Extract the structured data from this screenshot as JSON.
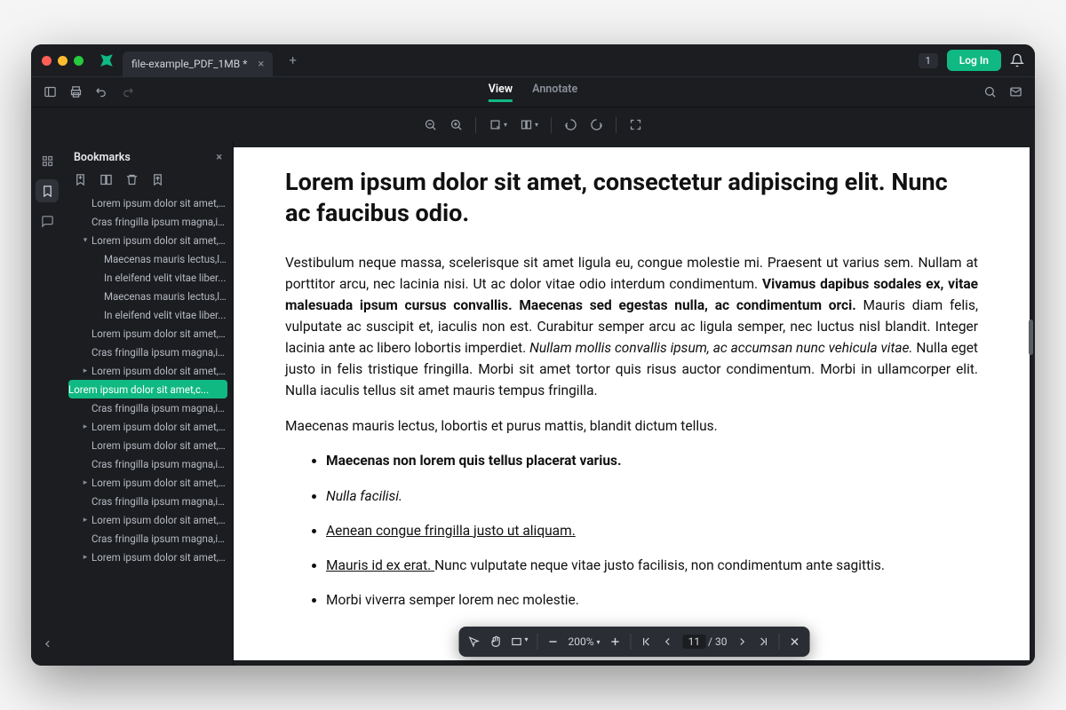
{
  "titlebar": {
    "tab_name": "file-example_PDF_1MB *",
    "count": "1",
    "login": "Log In"
  },
  "modes": {
    "view": "View",
    "annotate": "Annotate"
  },
  "sidebar": {
    "title": "Bookmarks",
    "items": [
      {
        "indent": 0,
        "chev": "",
        "label": "Lorem ipsum dolor sit amet,c..."
      },
      {
        "indent": 0,
        "chev": "",
        "label": "Cras fringilla ipsum magna,in..."
      },
      {
        "indent": 0,
        "chev": "v",
        "label": "Lorem ipsum dolor sit amet,c..."
      },
      {
        "indent": 1,
        "chev": "",
        "label": "Maecenas mauris lectus,l..."
      },
      {
        "indent": 1,
        "chev": "",
        "label": "In eleifend velit vitae liber..."
      },
      {
        "indent": 1,
        "chev": "",
        "label": "Maecenas mauris lectus,l..."
      },
      {
        "indent": 1,
        "chev": "",
        "label": "In eleifend velit vitae liber..."
      },
      {
        "indent": 0,
        "chev": "",
        "label": "Lorem ipsum dolor sit amet,c..."
      },
      {
        "indent": 0,
        "chev": "",
        "label": "Cras fringilla ipsum magna,in..."
      },
      {
        "indent": 0,
        "chev": ">",
        "label": "Lorem ipsum dolor sit amet,c..."
      },
      {
        "indent": 0,
        "chev": "",
        "label": "Lorem ipsum dolor sit amet,c...",
        "selected": true
      },
      {
        "indent": 0,
        "chev": "",
        "label": "Cras fringilla ipsum magna,in..."
      },
      {
        "indent": 0,
        "chev": ">",
        "label": "Lorem ipsum dolor sit amet,c..."
      },
      {
        "indent": 0,
        "chev": "",
        "label": "Lorem ipsum dolor sit amet,c..."
      },
      {
        "indent": 0,
        "chev": "",
        "label": "Cras fringilla ipsum magna,in..."
      },
      {
        "indent": 0,
        "chev": ">",
        "label": "Lorem ipsum dolor sit amet,c..."
      },
      {
        "indent": 0,
        "chev": "",
        "label": "Cras fringilla ipsum magna,in..."
      },
      {
        "indent": 0,
        "chev": ">",
        "label": "Lorem ipsum dolor sit amet,c..."
      },
      {
        "indent": 0,
        "chev": "",
        "label": "Cras fringilla ipsum magna,in..."
      },
      {
        "indent": 0,
        "chev": ">",
        "label": "Lorem ipsum dolor sit amet,c..."
      }
    ]
  },
  "doc": {
    "heading": "Lorem ipsum dolor sit amet, consectetur adipiscing elit. Nunc ac faucibus odio.",
    "p1_a": "Vestibulum neque massa, scelerisque sit amet ligula eu, congue molestie mi. Praesent ut varius sem. Nullam at porttitor arcu, nec lacinia nisi. Ut ac dolor vitae odio interdum condimentum. ",
    "p1_bold": "Vivamus dapibus sodales ex, vitae malesuada ipsum cursus convallis. Maecenas sed egestas nulla, ac condimentum orci.",
    "p1_b": " Mauris diam felis, vulputate ac suscipit et, iaculis non est. Curabitur semper arcu ac ligula semper, nec luctus nisl blandit. Integer lacinia ante ac libero lobortis imperdiet. ",
    "p1_ital": "Nullam mollis convallis ipsum, ac accumsan nunc vehicula vitae.",
    "p1_c": " Nulla eget justo in felis tristique fringilla. Morbi sit amet tortor quis risus auctor condimentum. Morbi in ullamcorper elit. Nulla iaculis tellus sit amet mauris tempus fringilla.",
    "p2": "Maecenas mauris lectus, lobortis et purus mattis, blandit dictum tellus.",
    "li1": "Maecenas non lorem quis tellus placerat varius.",
    "li2": "Nulla facilisi.",
    "li3": "Aenean congue fringilla justo ut aliquam. ",
    "li4_u": "Mauris id ex erat. ",
    "li4_rest": "Nunc vulputate neque vitae justo facilisis, non condimentum ante sagittis.",
    "li5": "Morbi viverra semper lorem nec molestie."
  },
  "float": {
    "zoom": "200%",
    "page": "11",
    "total": "30",
    "sep": "/"
  }
}
